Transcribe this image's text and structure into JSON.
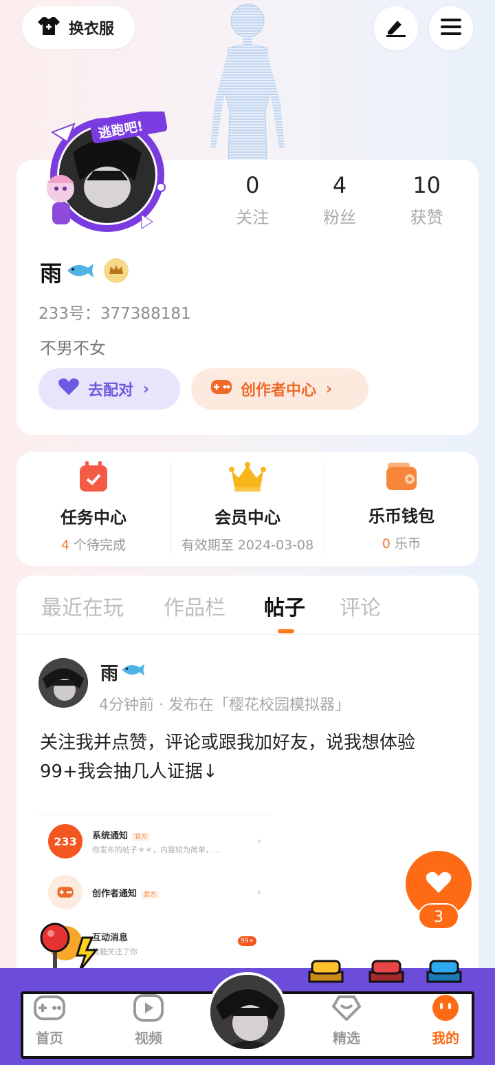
{
  "top_bar": {
    "outfit_label": "换衣服"
  },
  "profile": {
    "stats": [
      {
        "value": "0",
        "label": "关注"
      },
      {
        "value": "4",
        "label": "粉丝"
      },
      {
        "value": "10",
        "label": "获赞"
      }
    ],
    "name": "雨",
    "id_text": "233号：377388181",
    "bio": "不男不女",
    "match_label": "去配对",
    "creator_label": "创作者中心",
    "sticker_text": "逃跑吧!"
  },
  "services": [
    {
      "title": "任务中心",
      "highlight": "4",
      "sub": " 个待完成"
    },
    {
      "title": "会员中心",
      "highlight": "",
      "sub": "有效期至 2024-03-08"
    },
    {
      "title": "乐币钱包",
      "highlight": "0",
      "sub": " 乐币"
    }
  ],
  "tabs": [
    {
      "label": "最近在玩",
      "active": false
    },
    {
      "label": "作品栏",
      "active": false
    },
    {
      "label": "帖子",
      "active": true
    },
    {
      "label": "评论",
      "active": false
    }
  ],
  "post": {
    "author": "雨",
    "meta": "4分钟前 · 发布在「樱花校园模拟器」",
    "text": "关注我并点赞，评论或跟我加好友，说我想体验99+我会抽几人证据↓",
    "screenshot": {
      "rows": [
        {
          "icon_text": "233",
          "title": "系统通知",
          "tag": "官方",
          "desc": "你发布的帖子＊＊，内容较为简单，…"
        },
        {
          "icon_text": "",
          "title": "创作者通知",
          "tag": "官方",
          "desc": ""
        },
        {
          "icon_text": "",
          "title": "互动消息",
          "tag": "",
          "desc": "软糖关注了你",
          "badge": "99+"
        }
      ]
    }
  },
  "like": {
    "count": "3"
  },
  "nav": {
    "items": [
      {
        "label": "首页"
      },
      {
        "label": "视频"
      },
      {
        "label": "精选"
      },
      {
        "label": "我的"
      }
    ]
  },
  "colors": {
    "accent": "#ff6a14",
    "purple": "#6c4dd9",
    "match_text": "#6b5ae0"
  }
}
